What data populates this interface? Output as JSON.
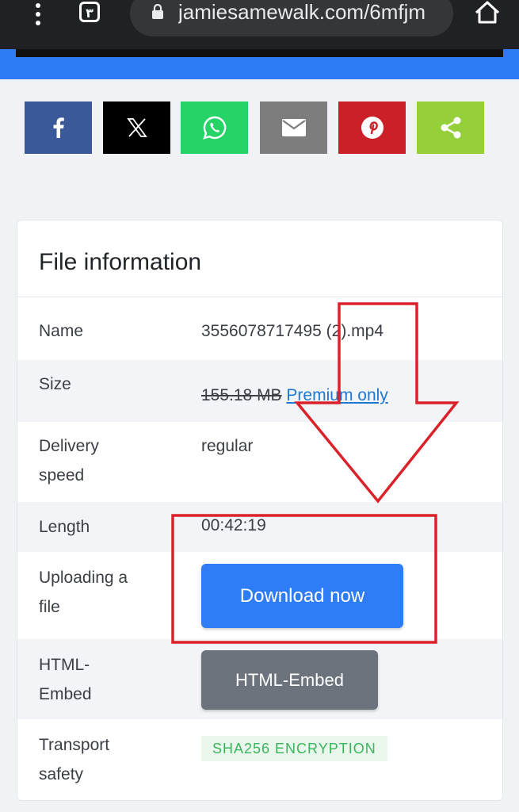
{
  "browser": {
    "tab_count": "٣",
    "url": "jamiesamewalk.com/6mfjm"
  },
  "share_buttons": [
    {
      "name": "facebook",
      "color": "#3b5998",
      "icon": "facebook-icon"
    },
    {
      "name": "x",
      "color": "#000000",
      "icon": "x-icon"
    },
    {
      "name": "whatsapp",
      "color": "#25d366",
      "icon": "whatsapp-icon"
    },
    {
      "name": "email",
      "color": "#7d7d7d",
      "icon": "mail-icon"
    },
    {
      "name": "pinterest",
      "color": "#cb2027",
      "icon": "pinterest-icon"
    },
    {
      "name": "share",
      "color": "#95d03a",
      "icon": "share-icon"
    }
  ],
  "file_info": {
    "title": "File information",
    "rows": {
      "name_label": "Name",
      "name_value": "3556078717495 (2).mp4",
      "size_label": "Size",
      "size_value": "155.18 MB",
      "size_premium": "Premium only",
      "delivery_label_1": "Delivery",
      "delivery_label_2": "speed",
      "delivery_value": "regular",
      "length_label": "Length",
      "length_value": "00:42:19",
      "uploading_label_1": "Uploading a",
      "uploading_label_2": "file",
      "download_button": "Download now",
      "embed_label_1": "HTML-",
      "embed_label_2": "Embed",
      "embed_button": "HTML-Embed",
      "transport_label_1": "Transport",
      "transport_label_2": "safety",
      "transport_badge": "SHA256 ENCRYPTION"
    }
  },
  "colors": {
    "accent_blue": "#2f7df6",
    "annotation_red": "#d9222a"
  }
}
